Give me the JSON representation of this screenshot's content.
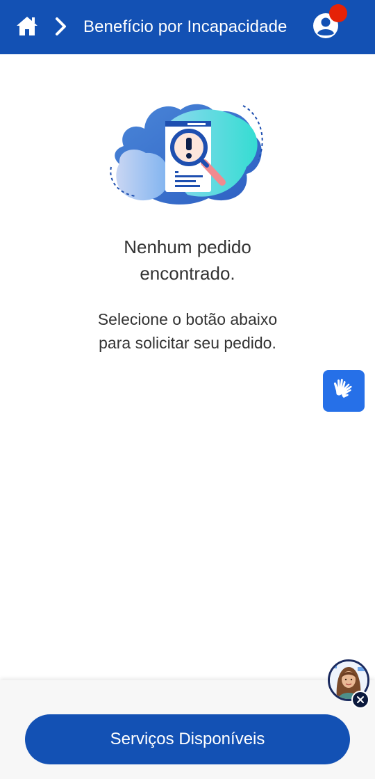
{
  "header": {
    "title": "Benefício por Incapacidade",
    "background": "#1351b4"
  },
  "icons": {
    "home": "home-icon",
    "breadcrumb": "chevron-right-icon",
    "user": "user-account-icon",
    "libras": "sign-language-icon",
    "close": "close-icon"
  },
  "empty_state": {
    "title_line1": "Nenhum pedido",
    "title_line2": "encontrado.",
    "subtitle_line1": "Selecione o botão abaixo",
    "subtitle_line2": "para solicitar seu pedido."
  },
  "footer": {
    "services_button": "Serviços Disponíveis"
  },
  "colors": {
    "primary": "#1351b4",
    "accent": "#2670e8",
    "notification": "#e52207",
    "text": "#333333"
  }
}
